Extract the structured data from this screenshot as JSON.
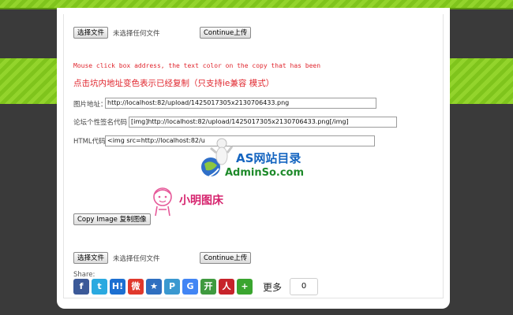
{
  "uploader_top": {
    "choose_label": "选择文件",
    "no_file_text": "未选择任何文件",
    "continue_label": "Continue上传"
  },
  "notice": {
    "english": "Mouse click box address, the text color on the copy that has been",
    "chinese": "点击坑内地址变色表示已经复制（只支持ie兼容 模式）"
  },
  "fields": [
    {
      "label": "图片地址：",
      "value": "http://localhost:82/upload/1425017305x2130706433.png"
    },
    {
      "label": "论坛个性签名代码",
      "value": "[img]http://localhost:82/upload/1425017305x2130706433.png[/img]"
    },
    {
      "label": "HTML代码",
      "value": "<img src=http://localhost:82/u"
    }
  ],
  "watermark": {
    "brand": "AS网站目录",
    "url": "AdminSo.com",
    "stamp": "小明图床"
  },
  "copy_button_label": "Copy Image 复制图像",
  "uploader_bottom": {
    "choose_label": "选择文件",
    "no_file_text": "未选择任何文件",
    "continue_label": "Continue上传"
  },
  "share": {
    "label": "Share:",
    "more_label": "更多",
    "count": "0",
    "icons": [
      {
        "name": "facebook-icon",
        "glyph": "f",
        "color": "#3b5998"
      },
      {
        "name": "twitter-icon",
        "glyph": "t",
        "color": "#2aa9e0"
      },
      {
        "name": "hatena-icon",
        "glyph": "H!",
        "color": "#1c6fd1"
      },
      {
        "name": "weibo-icon",
        "glyph": "微",
        "color": "#e0382c"
      },
      {
        "name": "favorite-star-icon",
        "glyph": "★",
        "color": "#2f6fc0"
      },
      {
        "name": "pinterest-icon",
        "glyph": "P",
        "color": "#3a98d0"
      },
      {
        "name": "google-icon",
        "glyph": "G",
        "color": "#4285f4"
      },
      {
        "name": "kaixin-icon",
        "glyph": "开",
        "color": "#3f9a3f"
      },
      {
        "name": "renren-icon",
        "glyph": "人",
        "color": "#c7232a"
      },
      {
        "name": "more-plus-icon",
        "glyph": "+",
        "color": "#3aa52f"
      }
    ]
  }
}
